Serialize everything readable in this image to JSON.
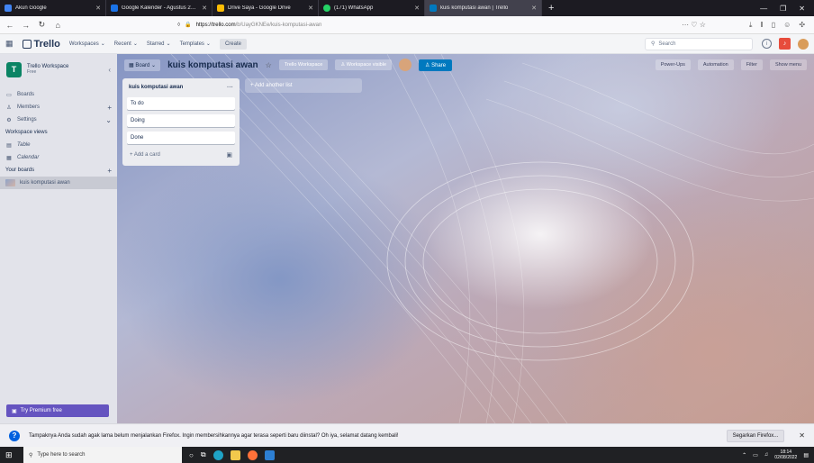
{
  "browser": {
    "tabs": [
      {
        "label": "Akun Google",
        "color": "#4285f4"
      },
      {
        "label": "Google Kalender - Agustus 2022",
        "color": "#1a73e8"
      },
      {
        "label": "Drive Saya - Google Drive",
        "color": "#fbbc04"
      },
      {
        "label": "(171) WhatsApp",
        "color": "#25d366"
      },
      {
        "label": "kuis komputasi awan | Trello",
        "color": "#0079bf"
      }
    ],
    "url_domain": "https://trello.com",
    "url_path": "/b/UayGKNEe/kuis-komputasi-awan",
    "page_actions": "··· ♡ ☆"
  },
  "header": {
    "logo": "Trello",
    "menus": [
      "Workspaces",
      "Recent",
      "Starred",
      "Templates"
    ],
    "create_label": "Create",
    "search_placeholder": "Search"
  },
  "sidebar": {
    "workspace_name": "Trello Workspace",
    "workspace_plan": "Free",
    "workspace_initial": "T",
    "items": [
      {
        "label": "Boards",
        "icon": "board-icon"
      },
      {
        "label": "Members",
        "icon": "members-icon"
      },
      {
        "label": "Settings",
        "icon": "settings-icon"
      }
    ],
    "views_title": "Workspace views",
    "views": [
      {
        "label": "Table",
        "icon": "table-icon"
      },
      {
        "label": "Calendar",
        "icon": "calendar-icon"
      }
    ],
    "boards_title": "Your boards",
    "boards": [
      "kuis komputasi awan"
    ],
    "premium_label": "Try Premium free"
  },
  "board": {
    "view_label": "Board",
    "title": "kuis komputasi awan",
    "workspace_label": "Trello Workspace",
    "visibility_label": "Workspace visible",
    "share_label": "Share",
    "right_actions": [
      "Power-Ups",
      "Automation",
      "Filter",
      "Show menu"
    ],
    "list": {
      "title": "kuis komputasi awan",
      "cards": [
        "To do",
        "Doing",
        "Done"
      ],
      "add_card_label": "+ Add a card"
    },
    "add_list_label": "+ Add another list"
  },
  "notification": {
    "text": "Tampaknya Anda sudah agak lama belum menjalankan Firefox. Ingin membersihkannya agar terasa seperti baru diinstal? Oh iya, selamat datang kembali!",
    "button_label": "Segarkan Firefox..."
  },
  "taskbar": {
    "search_placeholder": "Type here to search",
    "time": "18:14",
    "date": "02/08/2022"
  }
}
